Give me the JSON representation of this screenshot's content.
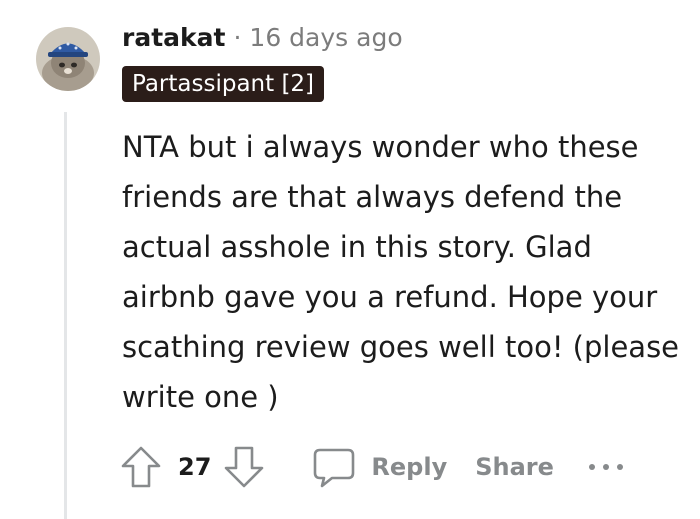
{
  "comment": {
    "username": "ratakat",
    "separator": "·",
    "timestamp": "16 days ago",
    "flair": "Partassipant [2]",
    "body": "NTA but i always wonder who these friends are that always defend the actual asshole in this story. Glad airbnb gave you a refund. Hope your scathing review goes well too! (please write one )",
    "score": "27",
    "reply_label": "Reply",
    "share_label": "Share"
  },
  "icons": {
    "avatar": "avatar-cat-with-blue-cap",
    "upvote": "arrow-up-icon",
    "downvote": "arrow-down-icon",
    "comment": "speech-bubble-icon",
    "more": "ellipsis-icon"
  },
  "colors": {
    "text": "#1c1c1c",
    "muted": "#7c7c7c",
    "action": "#878a8c",
    "flair_bg": "#2b1d19",
    "thread_line": "#e4e6e8"
  }
}
